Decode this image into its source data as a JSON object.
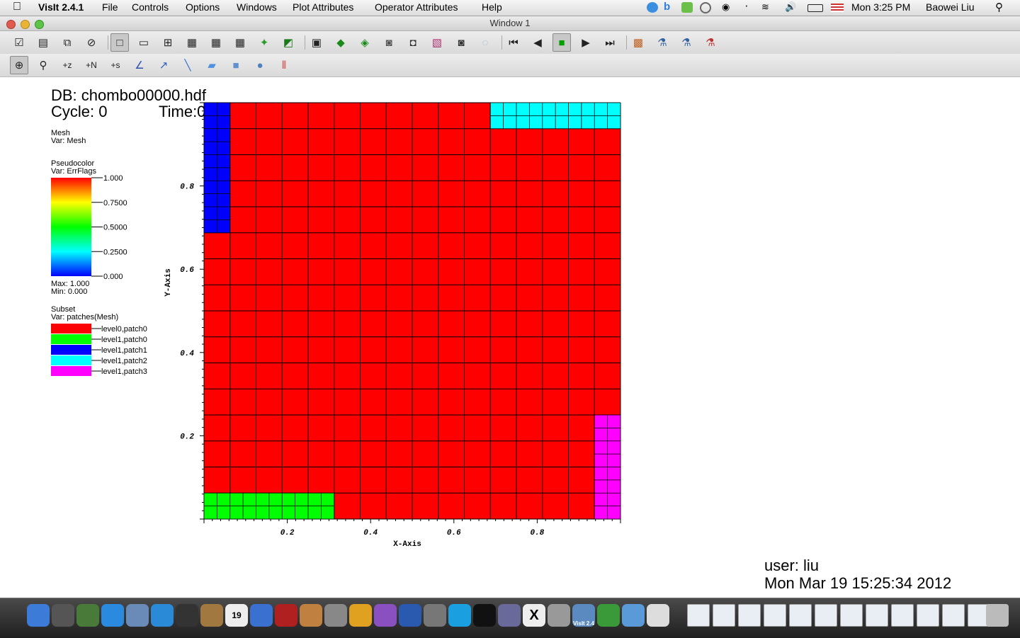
{
  "menubar": {
    "app_name": "VisIt 2.4.1",
    "menus": [
      "File",
      "Controls",
      "Options",
      "Windows",
      "Plot Attributes",
      "Operator Attributes",
      "Help"
    ],
    "clock": "Mon 3:25 PM",
    "user": "Baowei Liu"
  },
  "window": {
    "title": "Window 1"
  },
  "toolbar_main": {
    "icons": [
      "clear-icon",
      "open-icon",
      "copy-window-icon",
      "close-window-icon",
      "layout-1x1-icon",
      "layout-1x2-icon",
      "layout-2x2-icon",
      "layout-2x3-icon",
      "layout-2x4-icon",
      "layout-3x3-icon",
      "lock-view-icon",
      "lock-time-icon",
      "3d-view-icon",
      "rotate-icon",
      "spin-icon",
      "camera-icon",
      "save-image-icon",
      "pick-icon",
      "lineout-icon",
      "reset-icon",
      "first-frame-icon",
      "prev-frame-icon",
      "stop-icon",
      "play-icon",
      "next-frame-icon",
      "expressions-icon",
      "query-icon",
      "lighting-icon",
      "annotations-icon"
    ]
  },
  "toolbar_tools": {
    "icons": [
      "navigate-icon",
      "zoom-icon",
      "lineout-z-icon",
      "lineout-n-icon",
      "lineout-s-icon",
      "curve-icon",
      "pick-tool-icon",
      "line-tool-icon",
      "plane-tool-icon",
      "box-tool-icon",
      "sphere-tool-icon",
      "axis-restrict-icon"
    ]
  },
  "annotations": {
    "db": "DB: chombo00000.hdf",
    "cycle": "Cycle: 0",
    "time": "Time:0",
    "user": "user: liu",
    "date": "Mon Mar 19 15:25:34 2012"
  },
  "legends": {
    "mesh": {
      "title": "Mesh",
      "var": "Var: Mesh"
    },
    "pseudocolor": {
      "title": "Pseudocolor",
      "var": "Var: ErrFlags",
      "ticks": [
        "1.000",
        "0.7500",
        "0.5000",
        "0.2500",
        "0.000"
      ],
      "max": "Max:  1.000",
      "min": "Min:  0.000"
    },
    "subset": {
      "title": "Subset",
      "var": "Var: patches(Mesh)",
      "items": [
        {
          "label": "level0,patch0",
          "color": "#ff0000"
        },
        {
          "label": "level1,patch0",
          "color": "#00ff00"
        },
        {
          "label": "level1,patch1",
          "color": "#0000ff"
        },
        {
          "label": "level1,patch2",
          "color": "#00ffff"
        },
        {
          "label": "level1,patch3",
          "color": "#ff00ff"
        }
      ]
    }
  },
  "chart_data": {
    "type": "heatmap",
    "xlabel": "X-Axis",
    "ylabel": "Y-Axis",
    "xlim": [
      0,
      1
    ],
    "ylim": [
      0,
      1
    ],
    "xticks": [
      "0.2",
      "0.4",
      "0.6",
      "0.8"
    ],
    "yticks": [
      "0.8",
      "0.6",
      "0.4",
      "0.2"
    ],
    "xtick_values": [
      0.2,
      0.4,
      0.6,
      0.8
    ],
    "ytick_values": [
      0.8,
      0.6,
      0.4,
      0.2
    ],
    "coarse_grid": 16,
    "patches": [
      {
        "name": "level0,patch0",
        "color": "#ff0000",
        "x": [
          0,
          1
        ],
        "y": [
          0,
          1
        ],
        "cells": 16
      },
      {
        "name": "level1,patch0",
        "color": "#00ff00",
        "x": [
          0,
          0.3125
        ],
        "y": [
          0,
          0.0625
        ],
        "cells": 32
      },
      {
        "name": "level1,patch1",
        "color": "#0000ff",
        "x": [
          0,
          0.0625
        ],
        "y": [
          0.6875,
          1
        ],
        "cells": 32
      },
      {
        "name": "level1,patch2",
        "color": "#00ffff",
        "x": [
          0.6875,
          1
        ],
        "y": [
          0.9375,
          1
        ],
        "cells": 32
      },
      {
        "name": "level1,patch3",
        "color": "#ff00ff",
        "x": [
          0.9375,
          1
        ],
        "y": [
          0,
          0.25
        ],
        "cells": 32
      }
    ]
  },
  "dock": {
    "apps": [
      "finder-icon",
      "rocket-icon",
      "preview-icon",
      "app-store-icon",
      "photos-icon",
      "safari-icon",
      "facetime-icon",
      "contacts-icon",
      "calendar-icon",
      "itunes-icon",
      "photo-booth-icon",
      "iphoto-icon",
      "system-prefs-icon",
      "chrome-icon",
      "emacs-icon",
      "word-icon",
      "xcode-icon",
      "skype-icon",
      "terminal-icon",
      "preview2-icon",
      "x11-icon",
      "calculator-icon",
      "visit-icon",
      "chrome2-icon",
      "folder-icon",
      "document-icon"
    ],
    "calendar_day": "19",
    "visit_label": "VisIt 2.4"
  }
}
